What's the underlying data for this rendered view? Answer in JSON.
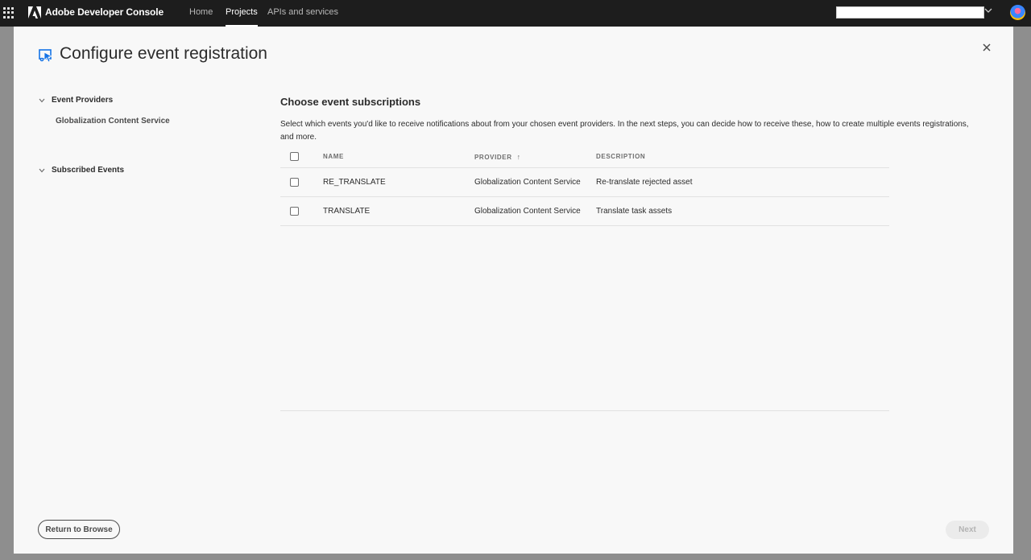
{
  "topbar": {
    "brand": "Adobe Developer Console",
    "nav": [
      {
        "label": "Home",
        "active": false
      },
      {
        "label": "Projects",
        "active": true
      },
      {
        "label": "APIs and services",
        "active": false
      }
    ],
    "org_selector_value": "",
    "icons": {
      "apps": "apps-grid-icon",
      "logo": "adobe-logo-icon",
      "avatar": "user-avatar"
    }
  },
  "modal": {
    "title": "Configure event registration",
    "title_icon": "event-registration-icon",
    "close_icon": "close-icon",
    "sidebar": {
      "sections": [
        {
          "label": "Event Providers",
          "items": [
            "Globalization Content Service"
          ]
        },
        {
          "label": "Subscribed Events",
          "items": []
        }
      ]
    },
    "main": {
      "title": "Choose event subscriptions",
      "description": "Select which events you'd like to receive notifications about from your chosen event providers. In the next steps, you can decide how to receive these, how to create multiple events registrations, and more.",
      "table": {
        "columns": [
          "NAME",
          "PROVIDER",
          "DESCRIPTION"
        ],
        "sorted_column": "PROVIDER",
        "sort_direction": "ascending",
        "rows": [
          {
            "name": "RE_TRANSLATE",
            "provider": "Globalization Content Service",
            "description": "Re-translate rejected asset",
            "checked": false
          },
          {
            "name": "TRANSLATE",
            "provider": "Globalization Content Service",
            "description": "Translate task assets",
            "checked": false
          }
        ]
      }
    },
    "footer": {
      "return_label": "Return to Browse",
      "next_label": "Next",
      "next_disabled": true
    }
  }
}
